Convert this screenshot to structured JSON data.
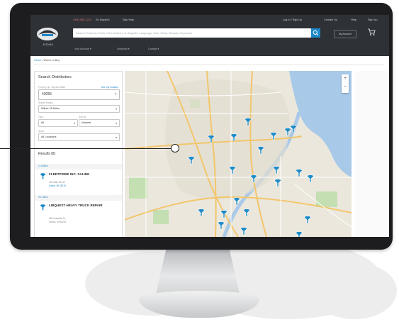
{
  "header": {
    "logo_text": "KODIAK",
    "util_links": [
      "▪ 800-555-1212",
      "En Español",
      "Skip Help"
    ],
    "util_right": [
      "Log In / Sign Up",
      "Contact Us",
      "Help",
      "Sign Up"
    ],
    "search_placeholder": "Search Products, Parts, Part Number, or Supplier. Language, Size, Other, Brands, Keywords",
    "account_label": "My Account",
    "subnav": [
      "Your Account ▾",
      "Solutions ▾",
      "Contact ▾"
    ]
  },
  "breadcrumb": {
    "link": "Home",
    "current": "/ Where to Buy"
  },
  "sidebar": {
    "title": "Search Distributors",
    "sub": "Find by zip, city and state",
    "sub_link": "Use my location",
    "zip_value": "43055",
    "zip_clear": "✕",
    "radius_label": "Search Radius",
    "radius_value": "Within 25 Miles",
    "type_label": "Type",
    "type_value": "All",
    "sort_label": "Sort by",
    "sort_value": "Nearest",
    "show_label": "Show",
    "show_value": "All Locations",
    "results_label": "Results (8)",
    "results": [
      {
        "distance": "2.4 Miles",
        "name": "FLEETPRIDE INC. SALINE",
        "line1": "123 Main Street",
        "line2": "Saline, MI 48176"
      },
      {
        "distance": "3.1 Miles",
        "name": "LIBQUEST HEAVY TRUCK REPAIR",
        "line1": "450 Industrial Dr",
        "line2": "Detroit, MI 48201"
      }
    ]
  },
  "map": {
    "zoom_in": "+",
    "zoom_out": "−"
  },
  "icons": {
    "logo": "brand-logo-icon",
    "search": "search-icon",
    "cart": "cart-icon",
    "pin": "map-pin-icon"
  },
  "colors": {
    "header": "#2e3136",
    "accent": "#1e88c9",
    "pin": "#1f8bc6",
    "water": "#a9c9e8",
    "park": "#c4dfb1"
  }
}
